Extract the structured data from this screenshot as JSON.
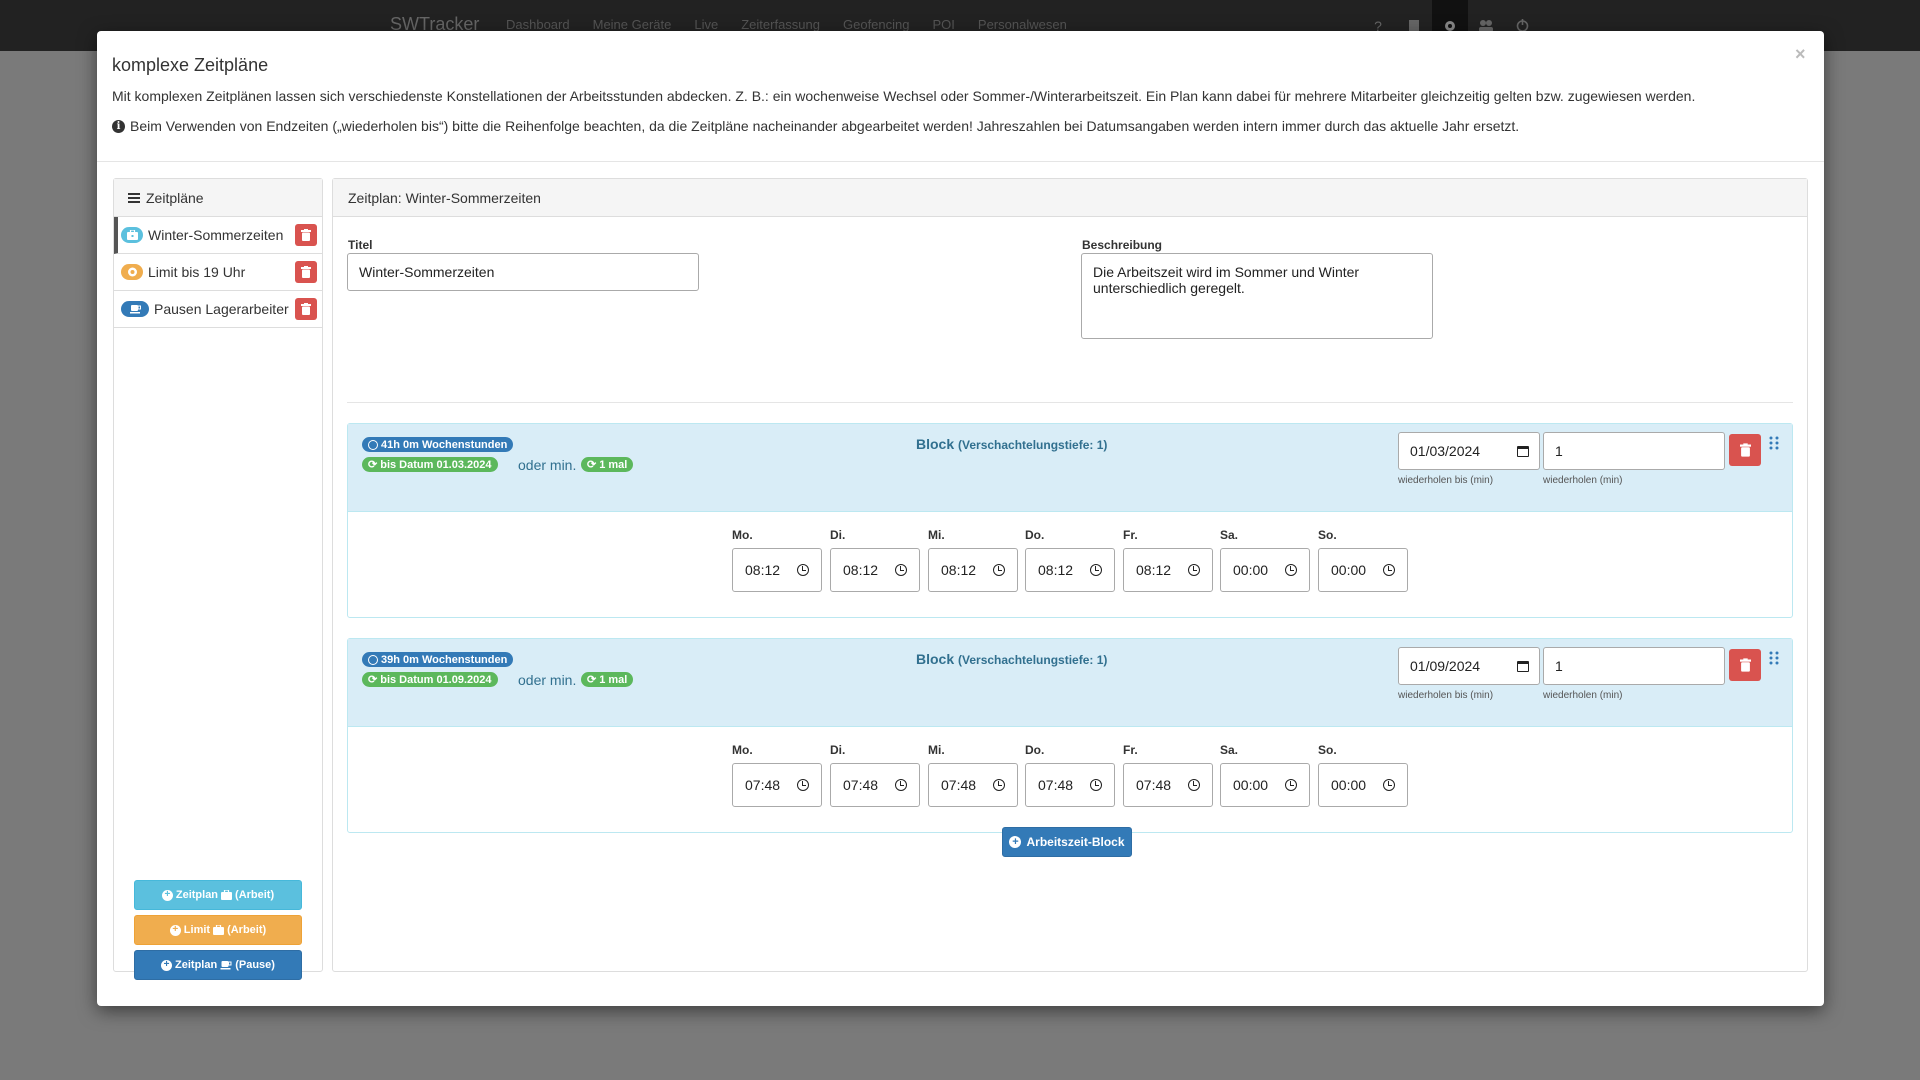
{
  "navbar": {
    "brand": "SWTracker",
    "links": [
      "Dashboard",
      "Meine Geräte",
      "Live",
      "Zeiterfassung",
      "Geofencing",
      "POI",
      "Personalwesen"
    ],
    "icons": [
      "help-icon",
      "book-icon",
      "gear-icon",
      "users-icon",
      "power-icon"
    ],
    "help_glyph": "?"
  },
  "modal": {
    "title": "komplexe Zeitpläne",
    "close": "×",
    "intro": "Mit komplexen Zeitplänen lassen sich verschiedenste Konstellationen der Arbeitsstunden abdecken. Z. B.: ein wochenweise Wechsel oder Sommer-/Winterarbeitszeit. Ein Plan kann dabei für mehrere Mitarbeiter gleichzeitig gelten bzw. zugewiesen werden.",
    "hint": "Beim Verwenden von Endzeiten („wiederholen bis“) bitte die Reihenfolge beachten, da die Zeitpläne nacheinander abgearbeitet werden! Jahreszahlen bei Datumsangaben werden intern immer durch das aktuelle Jahr ersetzt.",
    "hint_icon": "i"
  },
  "sidebar": {
    "header": "Zeitpläne",
    "items": [
      {
        "label": "Winter-Sommerzeiten",
        "icon": "briefcase-icon",
        "color": "#5bc0de",
        "active": true
      },
      {
        "label": "Limit bis 19 Uhr",
        "icon": "limit-icon",
        "color": "#f0ad4e",
        "active": false
      },
      {
        "label": "Pausen Lagerarbeiter",
        "icon": "coffee-icon",
        "color": "#337ab7",
        "active": false
      }
    ],
    "buttons": [
      {
        "plus": "+",
        "label": "Zeitplan",
        "suffix": "(Arbeit)",
        "color": "#5bc0de"
      },
      {
        "plus": "+",
        "label": "Limit",
        "suffix": "(Arbeit)",
        "color": "#f0ad4e"
      },
      {
        "plus": "+",
        "label": "Zeitplan",
        "suffix": "(Pause)",
        "color": "#337ab7"
      }
    ]
  },
  "main": {
    "header": "Zeitplan: Winter-Sommerzeiten",
    "title_label": "Titel",
    "title_value": "Winter-Sommerzeiten",
    "desc_label": "Beschreibung",
    "desc_value": "Die Arbeitszeit wird im Sommer und Winter unterschiedlich geregelt.",
    "blocks": [
      {
        "hours_badge": "41h 0m Wochenstunden",
        "until_badge": "bis Datum 01.03.2024",
        "or_text": "oder min.",
        "count_badge": "1 mal",
        "title": "Block",
        "depth": "(Verschachtelungstiefe: 1)",
        "repeat_until": "01/03/2024",
        "repeat_until_label": "wiederholen bis (min)",
        "repeat_count": "1",
        "repeat_count_label": "wiederholen (min)",
        "days": [
          {
            "label": "Mo.",
            "time": "08:12"
          },
          {
            "label": "Di.",
            "time": "08:12"
          },
          {
            "label": "Mi.",
            "time": "08:12"
          },
          {
            "label": "Do.",
            "time": "08:12"
          },
          {
            "label": "Fr.",
            "time": "08:12"
          },
          {
            "label": "Sa.",
            "time": "00:00"
          },
          {
            "label": "So.",
            "time": "00:00"
          }
        ]
      },
      {
        "hours_badge": "39h 0m Wochenstunden",
        "until_badge": "bis Datum 01.09.2024",
        "or_text": "oder min.",
        "count_badge": "1 mal",
        "title": "Block",
        "depth": "(Verschachtelungstiefe: 1)",
        "repeat_until": "01/09/2024",
        "repeat_until_label": "wiederholen bis (min)",
        "repeat_count": "1",
        "repeat_count_label": "wiederholen (min)",
        "days": [
          {
            "label": "Mo.",
            "time": "07:48"
          },
          {
            "label": "Di.",
            "time": "07:48"
          },
          {
            "label": "Mi.",
            "time": "07:48"
          },
          {
            "label": "Do.",
            "time": "07:48"
          },
          {
            "label": "Fr.",
            "time": "07:48"
          },
          {
            "label": "Sa.",
            "time": "00:00"
          },
          {
            "label": "So.",
            "time": "00:00"
          }
        ]
      }
    ],
    "add_block_plus": "+",
    "add_block_label": "Arbeitszeit-Block"
  },
  "colors": {
    "accent": "#337ab7",
    "info": "#5bc0de",
    "warning": "#f0ad4e",
    "danger": "#d9534f",
    "success": "#5cb85c",
    "block_bg": "#d9edf7"
  }
}
